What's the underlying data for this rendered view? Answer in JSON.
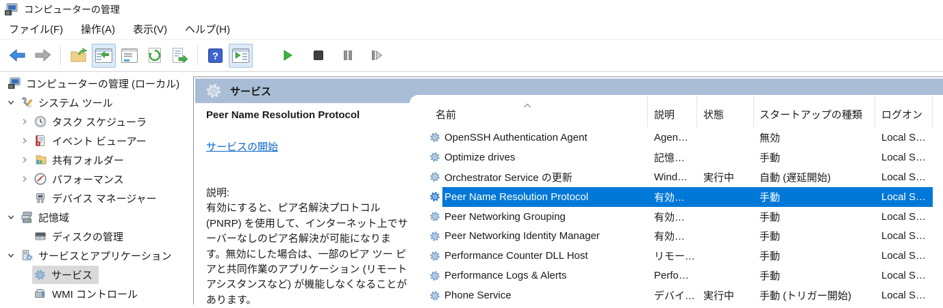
{
  "window": {
    "title": "コンピューターの管理"
  },
  "menu": {
    "items": [
      "ファイル(F)",
      "操作(A)",
      "表示(V)",
      "ヘルプ(H)"
    ]
  },
  "toolbar": {
    "icons": [
      "back-icon",
      "forward-icon",
      "export-wizard-icon",
      "show-console-tree-icon",
      "properties-icon",
      "refresh-icon",
      "export-list-icon",
      "help-icon",
      "show-action-pane-icon",
      "start-service-icon",
      "stop-service-icon",
      "pause-service-icon",
      "restart-service-icon"
    ]
  },
  "sidebar": {
    "items": [
      {
        "label": "コンピューターの管理 (ローカル)",
        "icon": "computer-management-icon",
        "level": 0,
        "expander": "none",
        "selected": false
      },
      {
        "label": "システム ツール",
        "icon": "system-tools-icon",
        "level": 1,
        "expander": "down",
        "selected": false
      },
      {
        "label": "タスク スケジューラ",
        "icon": "task-scheduler-icon",
        "level": 2,
        "expander": "right",
        "selected": false
      },
      {
        "label": "イベント ビューアー",
        "icon": "event-viewer-icon",
        "level": 2,
        "expander": "right",
        "selected": false
      },
      {
        "label": "共有フォルダー",
        "icon": "shared-folders-icon",
        "level": 2,
        "expander": "right",
        "selected": false
      },
      {
        "label": "パフォーマンス",
        "icon": "performance-icon",
        "level": 2,
        "expander": "right",
        "selected": false
      },
      {
        "label": "デバイス マネージャー",
        "icon": "device-manager-icon",
        "level": 2,
        "expander": "none",
        "selected": false
      },
      {
        "label": "記憶域",
        "icon": "storage-icon",
        "level": 1,
        "expander": "down",
        "selected": false
      },
      {
        "label": "ディスクの管理",
        "icon": "disk-management-icon",
        "level": 2,
        "expander": "none",
        "selected": false
      },
      {
        "label": "サービスとアプリケーション",
        "icon": "services-applications-icon",
        "level": 1,
        "expander": "down",
        "selected": false
      },
      {
        "label": "サービス",
        "icon": "services-icon",
        "level": 2,
        "expander": "none",
        "selected": true
      },
      {
        "label": "WMI コントロール",
        "icon": "wmi-control-icon",
        "level": 2,
        "expander": "none",
        "selected": false
      }
    ]
  },
  "main": {
    "header": {
      "title": "サービス",
      "icon": "gear-icon"
    },
    "details": {
      "service_name": "Peer Name Resolution Protocol",
      "action_link": "サービスの開始",
      "description_label": "説明:",
      "description": "有効にすると、ピア名解決プロトコル (PNRP) を使用して、インターネット上でサーバーなしのピア名解決が可能になります。無効にした場合は、一部のピア ツー ピアと共同作業のアプリケーション (リモート アシスタンスなど) が機能しなくなることがあります。"
    },
    "services": {
      "columns": [
        "名前",
        "説明",
        "状態",
        "スタートアップの種類",
        "ログオン"
      ],
      "sort_indicator": "ascending-on-name",
      "rows": [
        {
          "name": "OpenSSH Authentication Agent",
          "desc": "Agen…",
          "status": "",
          "startup": "無効",
          "logon": "Local S…",
          "selected": false
        },
        {
          "name": "Optimize drives",
          "desc": "記憶…",
          "status": "",
          "startup": "手動",
          "logon": "Local S…",
          "selected": false
        },
        {
          "name": "Orchestrator Service の更新",
          "desc": "Wind…",
          "status": "実行中",
          "startup": "自動 (遅延開始)",
          "logon": "Local S…",
          "selected": false
        },
        {
          "name": "Peer Name Resolution Protocol",
          "desc": "有効…",
          "status": "",
          "startup": "手動",
          "logon": "Local S…",
          "selected": true
        },
        {
          "name": "Peer Networking Grouping",
          "desc": "有効…",
          "status": "",
          "startup": "手動",
          "logon": "Local S…",
          "selected": false
        },
        {
          "name": "Peer Networking Identity Manager",
          "desc": "有効…",
          "status": "",
          "startup": "手動",
          "logon": "Local S…",
          "selected": false
        },
        {
          "name": "Performance Counter DLL Host",
          "desc": "リモー…",
          "status": "",
          "startup": "手動",
          "logon": "Local S…",
          "selected": false
        },
        {
          "name": "Performance Logs & Alerts",
          "desc": "Perfo…",
          "status": "",
          "startup": "手動",
          "logon": "Local S…",
          "selected": false
        },
        {
          "name": "Phone Service",
          "desc": "デバイ…",
          "status": "実行中",
          "startup": "手動 (トリガー開始)",
          "logon": "Local S…",
          "selected": false
        }
      ]
    }
  },
  "colors": {
    "selection_accent": "#0078d7",
    "header_band": "#a9bdd6",
    "link": "#0a64c8",
    "tree_selected_bg": "#d9d9d9",
    "gear_blue": "#7fa8cd"
  }
}
